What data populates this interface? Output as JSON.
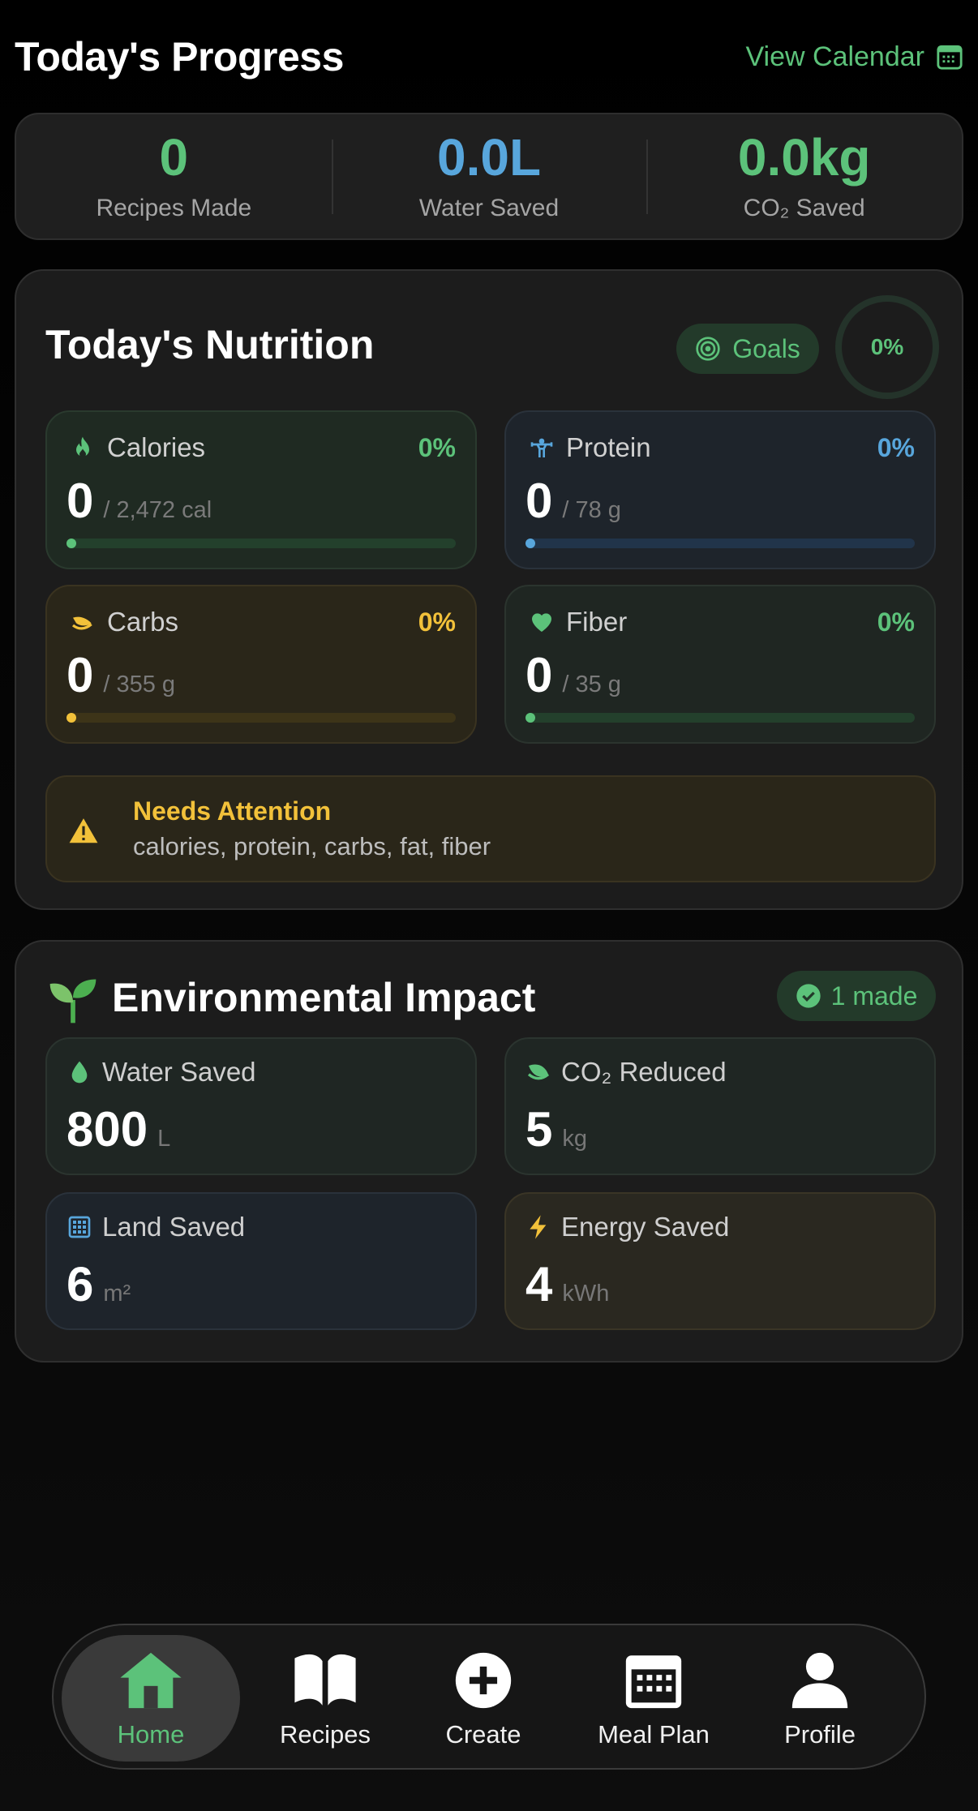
{
  "header": {
    "title": "Today's Progress",
    "view_calendar": "View Calendar"
  },
  "stats": [
    {
      "value": "0",
      "label": "Recipes Made",
      "color": "#5cc27a"
    },
    {
      "value": "0.0L",
      "label": "Water Saved",
      "color": "#58a6dc"
    },
    {
      "value": "0.0kg",
      "label": "CO₂ Saved",
      "color": "#5cc27a"
    }
  ],
  "nutrition": {
    "title": "Today's Nutrition",
    "goals_label": "Goals",
    "overall_percent": "0%",
    "tiles": [
      {
        "name": "Calories",
        "percent": "0%",
        "value": "0",
        "goal": "/ 2,472 cal",
        "icon": "flame-icon",
        "color": "#5cc27a",
        "progress": 0
      },
      {
        "name": "Protein",
        "percent": "0%",
        "value": "0",
        "goal": "/ 78 g",
        "icon": "weightlifter-icon",
        "color": "#58a6dc",
        "progress": 0
      },
      {
        "name": "Carbs",
        "percent": "0%",
        "value": "0",
        "goal": "/ 355 g",
        "icon": "wheat-icon",
        "color": "#f2c13a",
        "progress": 0
      },
      {
        "name": "Fiber",
        "percent": "0%",
        "value": "0",
        "goal": "/ 35 g",
        "icon": "heart-icon",
        "color": "#5cc27a",
        "progress": 0
      }
    ],
    "attention": {
      "title": "Needs Attention",
      "text": "calories, protein, carbs, fat, fiber"
    }
  },
  "environment": {
    "title": "Environmental Impact",
    "made_label": "1 made",
    "tiles": [
      {
        "name": "Water Saved",
        "value": "800",
        "unit": "L",
        "icon": "water-drop-icon"
      },
      {
        "name": "CO₂ Reduced",
        "value": "5",
        "unit": "kg",
        "icon": "leaf-icon"
      },
      {
        "name": "Land Saved",
        "value": "6",
        "unit": "m²",
        "icon": "grid-icon"
      },
      {
        "name": "Energy Saved",
        "value": "4",
        "unit": "kWh",
        "icon": "bolt-icon"
      }
    ]
  },
  "nav": [
    {
      "label": "Home",
      "icon": "home-icon",
      "active": true
    },
    {
      "label": "Recipes",
      "icon": "book-icon"
    },
    {
      "label": "Create",
      "icon": "plus-circle-icon"
    },
    {
      "label": "Meal Plan",
      "icon": "calendar-icon"
    },
    {
      "label": "Profile",
      "icon": "person-icon"
    }
  ]
}
